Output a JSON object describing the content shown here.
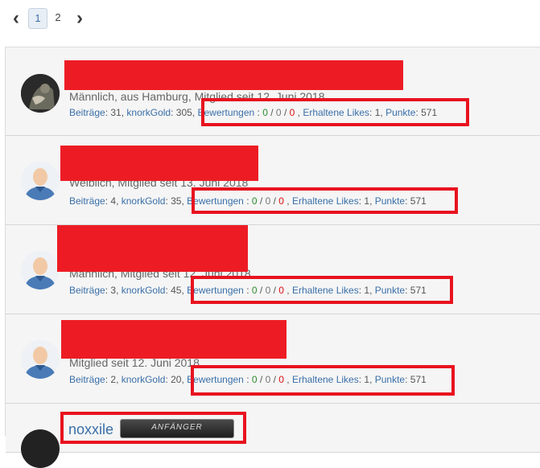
{
  "pagination": {
    "pages": [
      "1",
      "2"
    ],
    "current": "1"
  },
  "labels": {
    "posts": "Beiträge",
    "gold": "knorkGold",
    "ratings": "Bewertungen",
    "likes": "Erhaltene Likes",
    "points": "Punkte"
  },
  "members": [
    {
      "meta": "Männlich, aus Hamburg, Mitglied seit 12. Juni 2018",
      "posts": "31",
      "gold": "305",
      "rating_pos": "0",
      "rating_neu": "0",
      "rating_neg": "0",
      "likes": "1",
      "points": "571"
    },
    {
      "meta": "Weiblich, Mitglied seit 13. Juni 2018",
      "posts": "4",
      "gold": "35",
      "rating_pos": "0",
      "rating_neu": "0",
      "rating_neg": "0",
      "likes": "1",
      "points": "571"
    },
    {
      "meta": "Männlich, Mitglied seit 12. Juni 2018",
      "posts": "3",
      "gold": "45",
      "rating_pos": "0",
      "rating_neu": "0",
      "rating_neg": "0",
      "likes": "1",
      "points": "571"
    },
    {
      "meta": "Mitglied seit 12. Juni 2018",
      "posts": "2",
      "gold": "20",
      "rating_pos": "0",
      "rating_neu": "0",
      "rating_neg": "0",
      "likes": "1",
      "points": "571"
    },
    {
      "username": "noxxile",
      "rank": "ANFÄNGER"
    }
  ],
  "colors": {
    "link": "#3a6fa8",
    "highlight": "#e8131f",
    "positive": "#2e8b2e",
    "negative": "#dd1111"
  }
}
